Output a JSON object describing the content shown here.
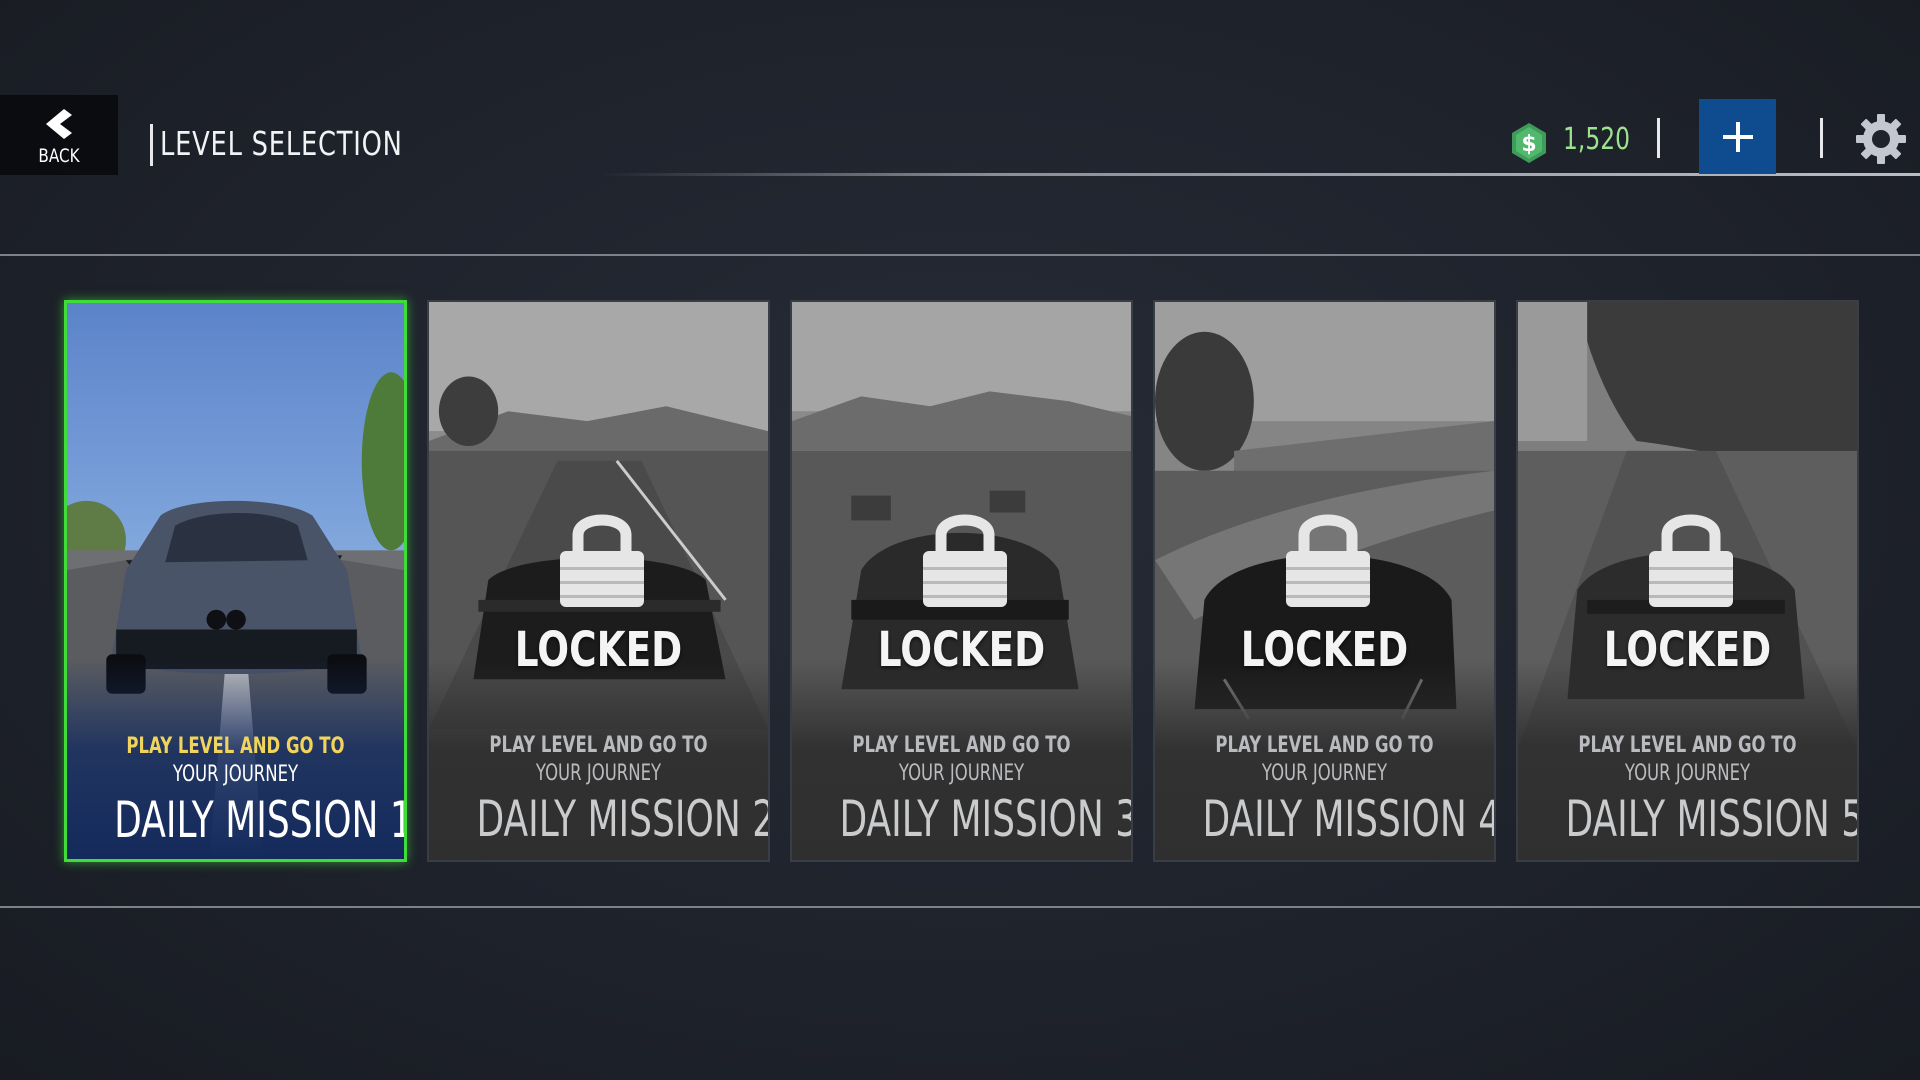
{
  "header": {
    "back_label": "BACK",
    "title": "LEVEL SELECTION",
    "currency_symbol": "$",
    "currency_value": "1,520"
  },
  "colors": {
    "accent_green": "#3fdc3a",
    "currency_green": "#9de28d",
    "add_button_blue": "#0e4b8f",
    "subtitle_yellow": "#f0d45c"
  },
  "missions": [
    {
      "title": "DAILY MISSION 1",
      "subtitle_line1": "PLAY LEVEL AND GO TO",
      "subtitle_line2": "YOUR JOURNEY",
      "status": "unlocked",
      "locked_label": ""
    },
    {
      "title": "DAILY MISSION 2",
      "subtitle_line1": "PLAY LEVEL AND GO TO",
      "subtitle_line2": "YOUR JOURNEY",
      "status": "locked",
      "locked_label": "LOCKED"
    },
    {
      "title": "DAILY MISSION 3",
      "subtitle_line1": "PLAY LEVEL AND GO TO",
      "subtitle_line2": "YOUR JOURNEY",
      "status": "locked",
      "locked_label": "LOCKED"
    },
    {
      "title": "DAILY MISSION 4",
      "subtitle_line1": "PLAY LEVEL AND GO TO",
      "subtitle_line2": "YOUR JOURNEY",
      "status": "locked",
      "locked_label": "LOCKED"
    },
    {
      "title": "DAILY MISSION 5",
      "subtitle_line1": "PLAY LEVEL AND GO TO",
      "subtitle_line2": "YOUR JOURNEY",
      "status": "locked",
      "locked_label": "LOCKED"
    }
  ]
}
